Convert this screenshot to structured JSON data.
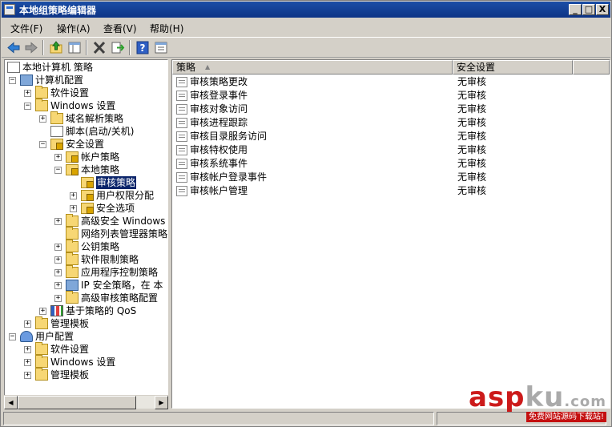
{
  "window": {
    "title": "本地组策略编辑器"
  },
  "caption_buttons": {
    "minimize": "_",
    "maximize": "□",
    "close": "X"
  },
  "menu": [
    {
      "label": "文件(F)"
    },
    {
      "label": "操作(A)"
    },
    {
      "label": "查看(V)"
    },
    {
      "label": "帮助(H)"
    }
  ],
  "toolbar": [
    {
      "icon": "back-arrow-icon"
    },
    {
      "icon": "forward-arrow-icon"
    },
    {
      "icon": "up-folder-icon"
    },
    {
      "icon": "show-hide-tree-icon"
    },
    {
      "icon": "delete-icon"
    },
    {
      "icon": "export-list-icon"
    },
    {
      "icon": "help-icon"
    },
    {
      "icon": "properties-icon"
    }
  ],
  "tree": [
    {
      "label": "本地计算机 策略",
      "icon": "doc",
      "expander": "",
      "level": 0
    },
    {
      "label": "计算机配置",
      "icon": "pc",
      "expander": "−",
      "level": 1
    },
    {
      "label": "软件设置",
      "icon": "folder",
      "expander": "+",
      "level": 2
    },
    {
      "label": "Windows 设置",
      "icon": "folder",
      "expander": "−",
      "level": 2
    },
    {
      "label": "域名解析策略",
      "icon": "folder",
      "expander": "+",
      "level": 3
    },
    {
      "label": "脚本(启动/关机)",
      "icon": "doc",
      "expander": "",
      "level": 3
    },
    {
      "label": "安全设置",
      "icon": "lockfolder",
      "expander": "−",
      "level": 3
    },
    {
      "label": "帐户策略",
      "icon": "lockfolder",
      "expander": "+",
      "level": 4
    },
    {
      "label": "本地策略",
      "icon": "lockfolder",
      "expander": "−",
      "level": 4
    },
    {
      "label": "审核策略",
      "icon": "lockfolder",
      "expander": "",
      "level": 5,
      "selected": true
    },
    {
      "label": "用户权限分配",
      "icon": "lockfolder",
      "expander": "+",
      "level": 5
    },
    {
      "label": "安全选项",
      "icon": "lockfolder",
      "expander": "+",
      "level": 5
    },
    {
      "label": "高级安全 Windows",
      "icon": "folder",
      "expander": "+",
      "level": 4
    },
    {
      "label": "网络列表管理器策略",
      "icon": "folder",
      "expander": "",
      "level": 4
    },
    {
      "label": "公钥策略",
      "icon": "folder",
      "expander": "+",
      "level": 4
    },
    {
      "label": "软件限制策略",
      "icon": "folder",
      "expander": "+",
      "level": 4
    },
    {
      "label": "应用程序控制策略",
      "icon": "folder",
      "expander": "+",
      "level": 4
    },
    {
      "label": "IP 安全策略，在 本",
      "icon": "pc",
      "expander": "+",
      "level": 4
    },
    {
      "label": "高级审核策略配置",
      "icon": "folder",
      "expander": "+",
      "level": 4
    },
    {
      "label": "基于策略的 QoS",
      "icon": "bars",
      "expander": "+",
      "level": 3
    },
    {
      "label": "管理模板",
      "icon": "folder",
      "expander": "+",
      "level": 2
    },
    {
      "label": "用户配置",
      "icon": "users",
      "expander": "−",
      "level": 1
    },
    {
      "label": "软件设置",
      "icon": "folder",
      "expander": "+",
      "level": 2
    },
    {
      "label": "Windows 设置",
      "icon": "folder",
      "expander": "+",
      "level": 2
    },
    {
      "label": "管理模板",
      "icon": "folder",
      "expander": "+",
      "level": 2
    }
  ],
  "list": {
    "columns": [
      "策略",
      "安全设置"
    ],
    "sort_indicator": "▲",
    "rows": [
      {
        "name": "审核策略更改",
        "value": "无审核"
      },
      {
        "name": "审核登录事件",
        "value": "无审核"
      },
      {
        "name": "审核对象访问",
        "value": "无审核"
      },
      {
        "name": "审核进程跟踪",
        "value": "无审核"
      },
      {
        "name": "审核目录服务访问",
        "value": "无审核"
      },
      {
        "name": "审核特权使用",
        "value": "无审核"
      },
      {
        "name": "审核系统事件",
        "value": "无审核"
      },
      {
        "name": "审核帐户登录事件",
        "value": "无审核"
      },
      {
        "name": "审核帐户管理",
        "value": "无审核"
      }
    ]
  },
  "watermark": {
    "logo_a": "asp",
    "logo_b": "ku",
    "logo_c": ".com",
    "tagline": "免费网站源码下载站!"
  },
  "colors": {
    "titlebar": "#1b4ea6",
    "selection": "#0a246a",
    "chrome": "#d4d0c8",
    "watermark_red": "#cc1a1a"
  }
}
